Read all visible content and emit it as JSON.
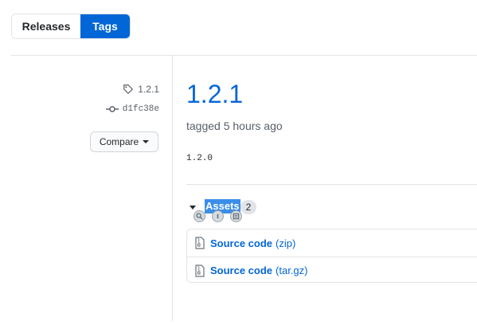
{
  "tabs": [
    {
      "label": "Releases",
      "active": false
    },
    {
      "label": "Tags",
      "active": true
    }
  ],
  "sidebar": {
    "tag": "1.2.1",
    "commit": "d1fc38e",
    "compare_label": "Compare"
  },
  "release": {
    "title": "1.2.1",
    "tagged_text": "tagged 5 hours ago",
    "body": "1.2.0"
  },
  "assets": {
    "label": "Assets",
    "count": "2",
    "items": [
      {
        "name": "Source code",
        "ext": "(zip)"
      },
      {
        "name": "Source code",
        "ext": "(tar.gz)"
      }
    ]
  },
  "colors": {
    "accent": "#0366d6",
    "selection": "#3b8ee8",
    "border": "#e1e4e8",
    "muted": "#586069"
  }
}
